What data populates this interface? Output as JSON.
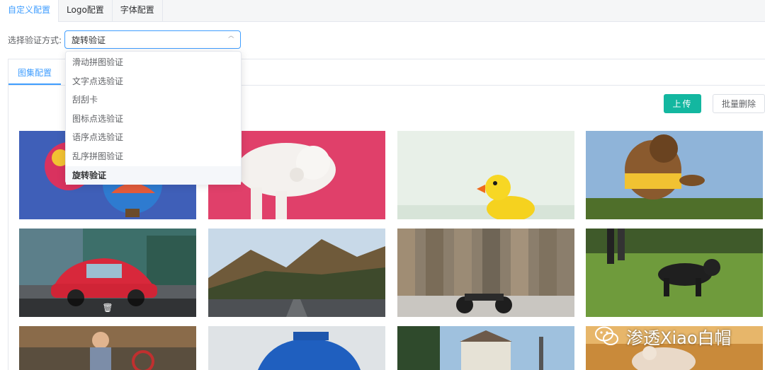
{
  "top_tabs": [
    {
      "label": "自定义配置"
    },
    {
      "label": "Logo配置"
    },
    {
      "label": "字体配置"
    }
  ],
  "verify_select": {
    "label": "选择验证方式:",
    "value": "旋转验证",
    "options": [
      "滑动拼图验证",
      "文字点选验证",
      "刮刮卡",
      "图标点选验证",
      "语序点选验证",
      "乱序拼图验证",
      "旋转验证"
    ]
  },
  "panel_tabs": [
    {
      "label": "图集配置"
    }
  ],
  "toolbar": {
    "upload_label": "上传",
    "batch_delete_label": "批量删除"
  },
  "gallery": {
    "images": [
      "hot-air-balloons",
      "white-poodle-pink",
      "rubber-duck",
      "dog-jumping",
      "red-beetle-car",
      "mountain-road",
      "motorcycle-wall",
      "dog-running-grass",
      "child-bicycle",
      "blue-scooter",
      "harbor-town",
      "dog-sunset"
    ],
    "delete_icon": "trash-icon"
  },
  "watermark": {
    "text": "渗透Xiao白帽",
    "icon": "wechat-icon"
  },
  "colors": {
    "accent": "#409eff",
    "upload": "#13b7a0"
  }
}
